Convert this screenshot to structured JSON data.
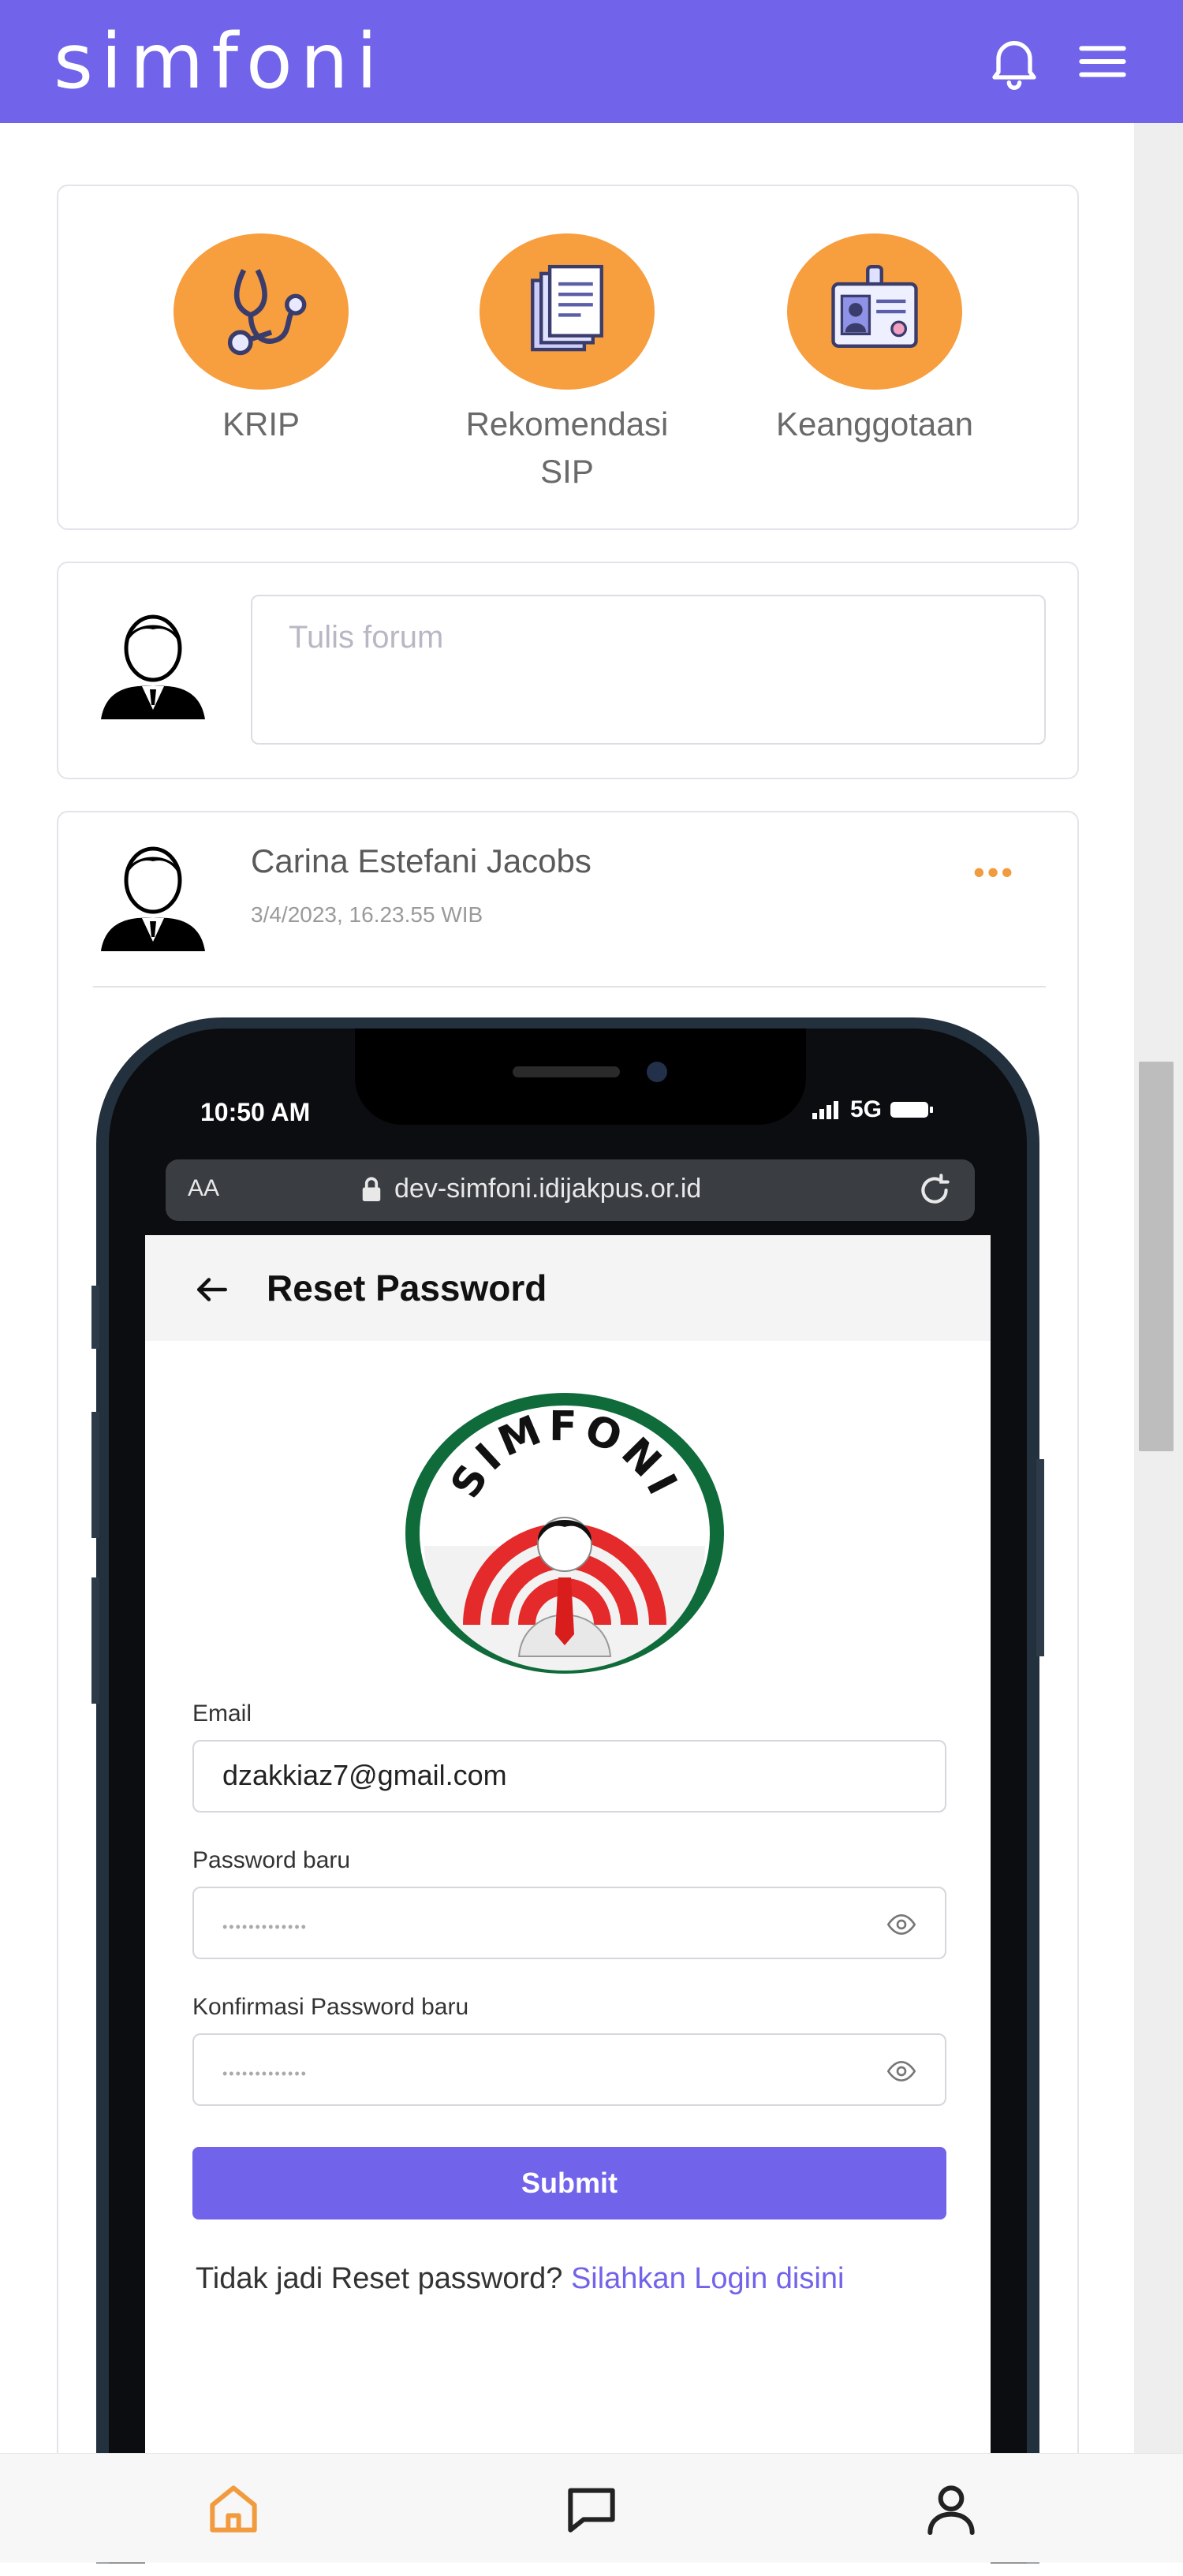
{
  "header": {
    "logo_text": "simfoni",
    "bell_icon": "bell-icon",
    "menu_icon": "hamburger-menu-icon",
    "background_color": "#7163ea"
  },
  "quick_menu": {
    "items": [
      {
        "label": "KRIP",
        "icon": "stethoscope-icon"
      },
      {
        "label": "Rekomendasi SIP",
        "icon": "documents-icon"
      },
      {
        "label": "Keanggotaan",
        "icon": "id-card-icon"
      }
    ],
    "circle_color": "#f79e3f"
  },
  "compose": {
    "placeholder": "Tulis forum"
  },
  "post": {
    "author": "Carina Estefani Jacobs",
    "timestamp": "3/4/2023, 16.23.55 WIB",
    "more_icon": "more-dots-icon",
    "image": {
      "status_time": "10:50 AM",
      "status_network": "5G",
      "url_aa": "AA",
      "url": "dev-simfoni.idijakpus.or.id",
      "screen_title": "Reset Password",
      "emblem_text": "SIMFONI",
      "email_label": "Email",
      "email_value": "dzakkiaz7@gmail.com",
      "password_label": "Password baru",
      "password_value": "•••••••••••••",
      "confirm_label": "Konfirmasi Password baru",
      "confirm_value": "•••••••••••••",
      "submit_label": "Submit",
      "login_prompt": "Tidak jadi Reset password?",
      "login_link": "Silahkan Login disini"
    }
  },
  "bottom_nav": {
    "items": [
      {
        "icon": "home-icon",
        "active": true
      },
      {
        "icon": "chat-icon",
        "active": false
      },
      {
        "icon": "profile-icon",
        "active": false
      }
    ],
    "active_color": "#f29b3e"
  }
}
